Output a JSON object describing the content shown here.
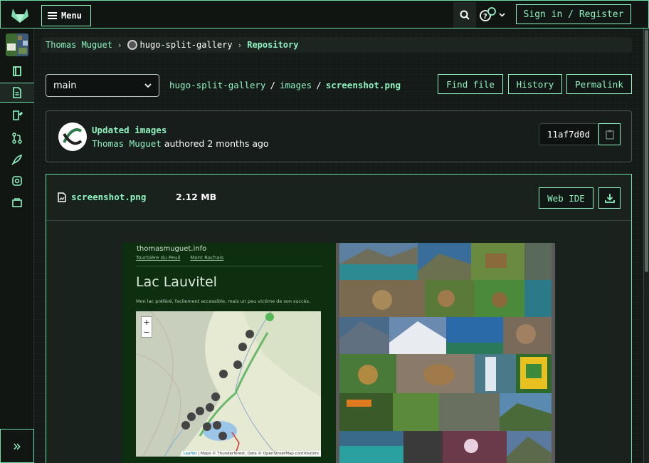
{
  "topbar": {
    "menu_label": "Menu",
    "signin_label": "Sign in / Register"
  },
  "breadcrumb": {
    "owner": "Thomas Muguet",
    "project": "hugo-split-gallery",
    "section": "Repository"
  },
  "branch": {
    "selected": "main"
  },
  "path": {
    "project": "hugo-split-gallery",
    "folder": "images",
    "file": "screenshot.png"
  },
  "actions": {
    "find_file": "Find file",
    "history": "History",
    "permalink": "Permalink"
  },
  "commit": {
    "title": "Updated images",
    "author": "Thomas Muguet",
    "meta": "authored 2 months ago",
    "sha": "11af7d0d"
  },
  "file": {
    "name": "screenshot.png",
    "size": "2.12 MB",
    "web_ide_label": "Web IDE"
  },
  "preview": {
    "site_name": "thomasmuguet.info",
    "prev_link": "Tourbière du Peuil",
    "next_link": "Mont Rachais",
    "title": "Lac Lauvitel",
    "description": "Mon lac préféré, facilement accessible, mais un peu victime de son succès.",
    "zoom_in": "+",
    "zoom_out": "−",
    "attribution_leaflet": "Leaflet",
    "attribution_text": " | Maps © Thunderforest, Data © OpenStreetMap contributors"
  },
  "colors": {
    "accent": "#8ef3c0",
    "border": "#6fdca8",
    "background": "#141a17"
  },
  "icons": [
    "gitlab-logo-icon",
    "search-icon",
    "help-icon",
    "chevron-down-icon",
    "project-icon",
    "repository-icon",
    "issues-icon",
    "merge-request-icon",
    "deployments-icon",
    "releases-icon",
    "packages-icon",
    "expand-sidebar-icon",
    "copy-icon",
    "file-image-icon",
    "download-icon"
  ]
}
